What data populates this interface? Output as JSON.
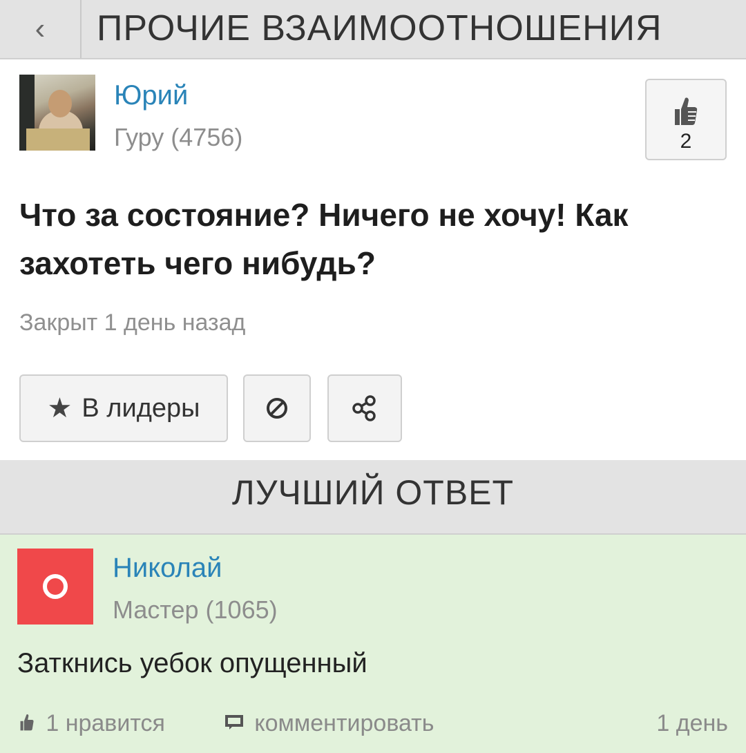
{
  "header": {
    "back_icon": "chevron-left-icon",
    "back_glyph": "‹",
    "title": "ПРОЧИЕ ВЗАИМООТНОШЕНИЯ"
  },
  "question": {
    "author": {
      "name": "Юрий",
      "rank": "Гуру (4756)"
    },
    "likes": {
      "icon": "thumbs-up-icon",
      "count": "2"
    },
    "text": "Что за состояние? Ничего не хочу! Как захотеть чего нибудь?",
    "status": "Закрыт 1 день назад",
    "actions": {
      "leaders_label": "В лидеры",
      "leaders_icon": "star-icon",
      "block_icon": "block-icon",
      "share_icon": "share-icon"
    }
  },
  "best_answer": {
    "section_title": "ЛУЧШИЙ ОТВЕТ",
    "author": {
      "name": "Николай",
      "rank": "Мастер (1065)",
      "avatar_color": "#f0484a"
    },
    "text": "Заткнись уебок опущенный",
    "footer": {
      "likes_label": "1 нравится",
      "comment_label": "комментировать",
      "time": "1 день"
    }
  },
  "colors": {
    "link": "#2a84b8",
    "header_bg": "#e3e3e3",
    "answer_bg": "#e2f2db"
  }
}
